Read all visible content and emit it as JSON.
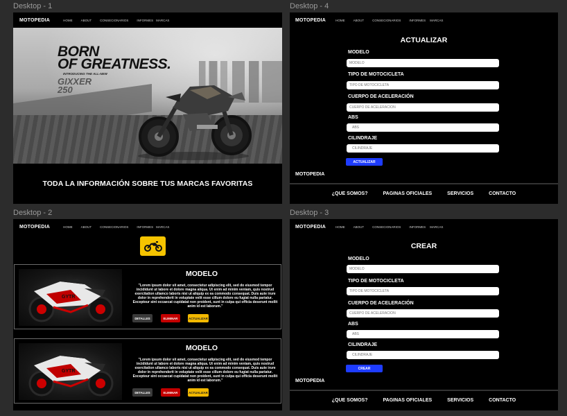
{
  "frames": {
    "d1": "Desktop - 1",
    "d2": "Desktop - 2",
    "d3": "Desktop - 3",
    "d4": "Desktop - 4"
  },
  "nav": {
    "brand": "MOTOPEDIA",
    "links": [
      "HOME",
      "ABOUT",
      "CONSECIONARIOS",
      "INFORMES",
      "MARCAS"
    ]
  },
  "hero": {
    "headline": "BORN\nOF GREATNESS.",
    "intro": "INTRODUCING THE ALL-NEW",
    "model": "GIXXER 250"
  },
  "tagline": "TODA LA INFORMACIÓN SOBRE TUS MARCAS FAVORITAS",
  "form": {
    "fields": [
      {
        "label": "MODELO",
        "placeholder": "MODELO"
      },
      {
        "label": "TIPO DE MOTOCICLETA",
        "placeholder": "TIPO DE MOTOCICLETA"
      },
      {
        "label": "CUERPO DE ACELERACIÓN",
        "placeholder": "CUERPO DE ACELERACIÓN"
      },
      {
        "label": "ABS",
        "placeholder": "ABS"
      },
      {
        "label": "CILINDRAJE",
        "placeholder": "CILINDRAJE"
      }
    ],
    "update_title": "ACTUALIZAR",
    "update_button": "ACTUALIZAR",
    "create_title": "CREAR",
    "create_button": "CREAR"
  },
  "footer": {
    "brand": "MOTOPEDIA",
    "links": [
      "¿QUE SOMOS?",
      "PAGINAS OFICIALES",
      "SERVICIOS",
      "CONTACTO"
    ]
  },
  "catalog": {
    "cards": [
      {
        "title": "MODELO",
        "description": "\"Lorem ipsum dolor sit amet, consectetur adipiscing elit, sed do eiusmod tempor incididunt ut labore et dolore magna aliqua. Ut enim ad minim veniam, quis nostrud exercitation ullamco laboris nisi ut aliquip ex ea commodo consequat. Duis aute irure dolor in reprehenderit in voluptate velit esse cillum dolore eu fugiat nulla pariatur. Excepteur sint occaecat cupidatat non proident, sunt in culpa qui officia deserunt mollit anim id est laborum.\"",
        "details": "DETALLES",
        "delete": "ELIMINAR",
        "update": "ACTUALIZAR"
      },
      {
        "title": "MODELO",
        "description": "\"Lorem ipsum dolor sit amet, consectetur adipiscing elit, sed do eiusmod tempor incididunt ut labore et dolore magna aliqua. Ut enim ad minim veniam, quis nostrud exercitation ullamco laboris nisi ut aliquip ex ea commodo consequat. Duis aute irure dolor in reprehenderit in voluptate velit esse cillum dolore eu fugiat nulla pariatur. Excepteur sint occaecat cupidatat non proident, sunt in culpa qui officia deserunt mollit anim id est laborum.\"",
        "details": "DETALLES",
        "delete": "ELIMINAR",
        "update": "ACTUALIZAR"
      }
    ]
  },
  "colors": {
    "accent_blue": "#1e3cff",
    "badge_yellow": "#f6c400",
    "delete_red": "#c40000",
    "update_yellow": "#f2b800"
  },
  "icons": {
    "badge": "motorcycle-icon"
  }
}
